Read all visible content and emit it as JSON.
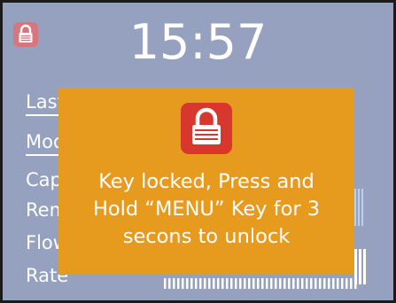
{
  "screen": {
    "clock": "15:57",
    "lock_icon": "padlock-icon",
    "colors": {
      "background": "#96a1c0",
      "text": "#ffffff",
      "overlay": "#e69a1e",
      "lock_badge": "#d7372c",
      "lock_badge_dim": "#d7767c"
    }
  },
  "menu": {
    "items": [
      {
        "label": "Last"
      },
      {
        "label": "Mode"
      },
      {
        "label": "Capacity"
      },
      {
        "label": "Remaining"
      },
      {
        "label": "Flow"
      },
      {
        "label": "Rate"
      }
    ]
  },
  "dialog": {
    "icon": "padlock-icon",
    "message_lines": [
      "Key locked, Press and",
      "Hold “MENU” Key for 3",
      "secons to unlock"
    ]
  }
}
